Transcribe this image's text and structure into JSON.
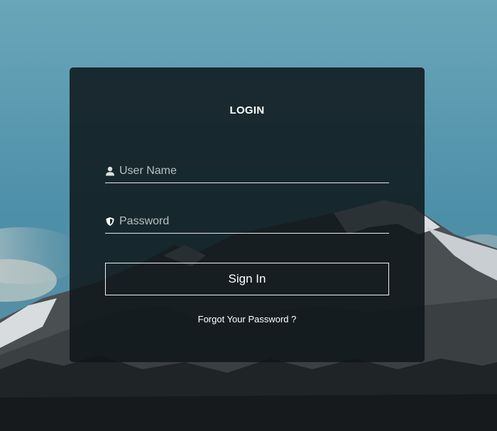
{
  "login": {
    "title": "LOGIN",
    "username": {
      "placeholder": "User Name",
      "value": "",
      "icon": "user-icon"
    },
    "password": {
      "placeholder": "Password",
      "value": "",
      "icon": "shield-icon"
    },
    "sign_in_label": "Sign In",
    "forgot_password_label": "Forgot Your Password ?"
  },
  "colors": {
    "sky": "#5d97ab",
    "card": "#0e161a",
    "text": "#ffffff",
    "placeholder": "#b9bfc2",
    "underline": "#e8e8e8"
  }
}
